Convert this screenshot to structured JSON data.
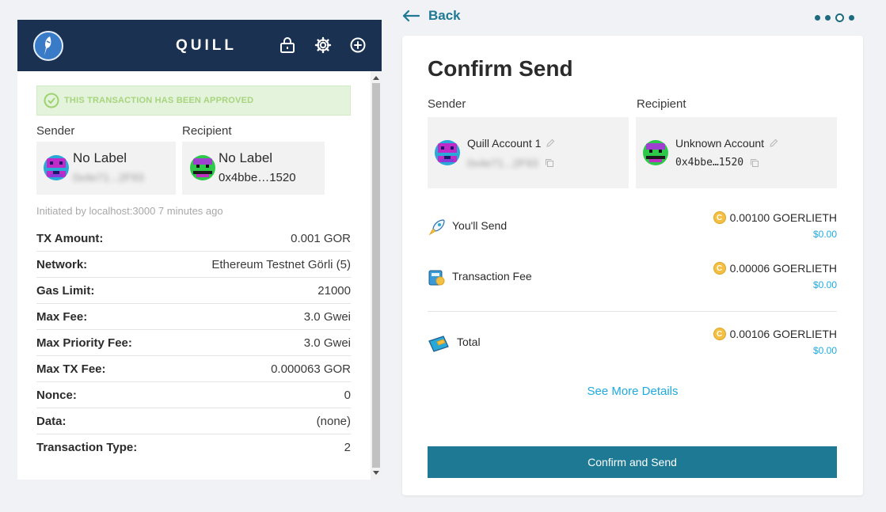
{
  "extension": {
    "title": "QUILL",
    "header_icons": [
      "lock-icon",
      "gear-icon",
      "plus-circle-icon"
    ],
    "banner": "THIS TRANSACTION HAS BEEN APPROVED",
    "sender_label": "Sender",
    "recipient_label": "Recipient",
    "sender": {
      "name": "No Label",
      "address": "0x4e71...2F93"
    },
    "recipient": {
      "name": "No Label",
      "address": "0x4bbe…1520"
    },
    "initiated": "Initiated by localhost:3000 7 minutes ago",
    "details": [
      {
        "key": "TX Amount:",
        "value": "0.001 GOR"
      },
      {
        "key": "Network:",
        "value": "Ethereum Testnet Görli (5)"
      },
      {
        "key": "Gas Limit:",
        "value": "21000"
      },
      {
        "key": "Max Fee:",
        "value": "3.0 Gwei"
      },
      {
        "key": "Max Priority Fee:",
        "value": "3.0 Gwei"
      },
      {
        "key": "Max TX Fee:",
        "value": "0.000063 GOR"
      },
      {
        "key": "Nonce:",
        "value": "0"
      },
      {
        "key": "Data:",
        "value": "(none)"
      },
      {
        "key": "Transaction Type:",
        "value": "2"
      }
    ]
  },
  "page": {
    "back_label": "Back",
    "step_total": 4,
    "step_current": 3,
    "title": "Confirm Send",
    "sender_label": "Sender",
    "recipient_label": "Recipient",
    "sender": {
      "name": "Quill Account 1",
      "address": "0x4e71...2F93"
    },
    "recipient": {
      "name": "Unknown Account",
      "address": "0x4bbe…1520"
    },
    "send": {
      "label": "You'll Send",
      "amount": "0.00100 GOERLIETH",
      "usd": "$0.00"
    },
    "fee": {
      "label": "Transaction Fee",
      "amount": "0.00006 GOERLIETH",
      "usd": "$0.00"
    },
    "total": {
      "label": "Total",
      "amount": "0.00106 GOERLIETH",
      "usd": "$0.00"
    },
    "see_more": "See More Details",
    "confirm": "Confirm and Send"
  },
  "colors": {
    "header": "#1a3152",
    "accent": "#1d7994",
    "link": "#1eaae0",
    "approved": "#a8d47e"
  }
}
